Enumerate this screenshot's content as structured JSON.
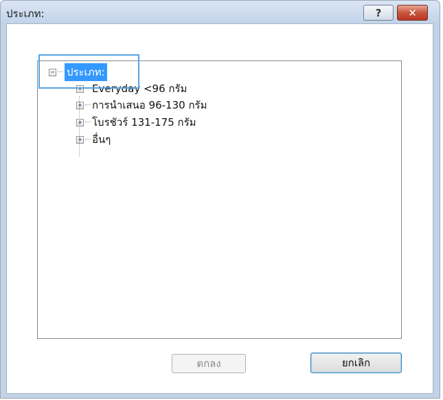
{
  "window": {
    "title": "ประเภท:",
    "help_label": "?",
    "close_label": "✕"
  },
  "tree": {
    "root_expander": "−",
    "root_label": "ประเภท:",
    "items": [
      {
        "expander": "+",
        "label": "Everyday <96 กรัม"
      },
      {
        "expander": "+",
        "label": "การนำเสนอ 96-130 กรัม"
      },
      {
        "expander": "+",
        "label": "โบรชัวร์ 131-175 กรัม"
      },
      {
        "expander": "+",
        "label": "อื่นๆ"
      }
    ]
  },
  "buttons": {
    "ok_label": "ตกลง",
    "cancel_label": "ยกเลิก"
  },
  "colors": {
    "selection": "#3399ff",
    "focus_frame": "#58a3e0",
    "close_button": "#c8553d"
  }
}
